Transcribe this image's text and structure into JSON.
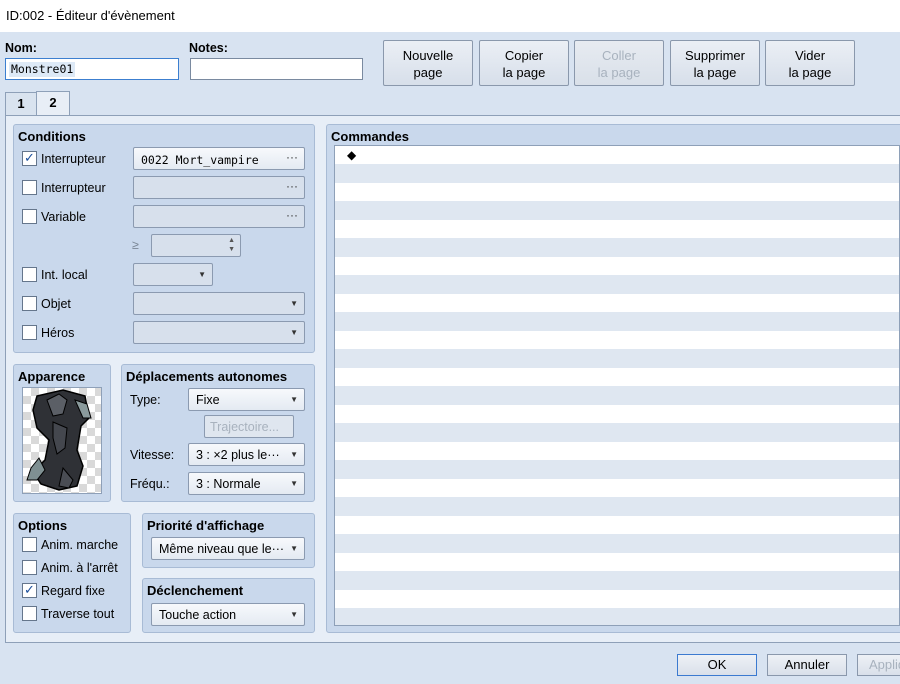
{
  "window": {
    "title": "ID:002 - Éditeur d'évènement"
  },
  "header": {
    "name_label": "Nom:",
    "name_value": "Monstre01",
    "notes_label": "Notes:",
    "notes_value": ""
  },
  "toolbar": {
    "new_page": [
      "Nouvelle",
      "page"
    ],
    "copy_page": [
      "Copier",
      "la page"
    ],
    "paste_page": [
      "Coller",
      "la page"
    ],
    "delete_page": [
      "Supprimer",
      "la page"
    ],
    "clear_page": [
      "Vider",
      "la page"
    ]
  },
  "tabs": [
    {
      "label": "1"
    },
    {
      "label": "2"
    }
  ],
  "conditions": {
    "title": "Conditions",
    "switch1": {
      "label": "Interrupteur",
      "checked": true,
      "value": "0022 Mort_vampire"
    },
    "switch2": {
      "label": "Interrupteur",
      "checked": false,
      "value": ""
    },
    "variable": {
      "label": "Variable",
      "checked": false,
      "value": "",
      "compare": "≥",
      "number": ""
    },
    "self_switch": {
      "label": "Int. local",
      "checked": false
    },
    "item": {
      "label": "Objet",
      "checked": false
    },
    "actor": {
      "label": "Héros",
      "checked": false
    },
    "more_glyph": "···"
  },
  "appearance": {
    "title": "Apparence",
    "icon": "vampire-sprite"
  },
  "autonomous": {
    "title": "Déplacements autonomes",
    "type_label": "Type:",
    "type_value": "Fixe",
    "route_button": "Trajectoire...",
    "speed_label": "Vitesse:",
    "speed_value": "3 : ×2 plus le···",
    "freq_label": "Fréqu.:",
    "freq_value": "3 : Normale"
  },
  "options": {
    "title": "Options",
    "walking": {
      "label": "Anim. marche",
      "checked": false
    },
    "stepping": {
      "label": "Anim. à l'arrêt",
      "checked": false
    },
    "direction_fix": {
      "label": "Regard fixe",
      "checked": true
    },
    "through": {
      "label": "Traverse tout",
      "checked": false
    }
  },
  "priority": {
    "title": "Priorité d'affichage",
    "value": "Même niveau que le···"
  },
  "trigger": {
    "title": "Déclenchement",
    "value": "Touche action"
  },
  "commands": {
    "title": "Commandes",
    "first_row": "◆"
  },
  "footer": {
    "ok": "OK",
    "cancel": "Annuler",
    "apply": "Appliquer"
  },
  "colors": {
    "accent": "#3b7ad0",
    "panel": "#c9d8ec",
    "stripe": "#dfe7f1"
  }
}
